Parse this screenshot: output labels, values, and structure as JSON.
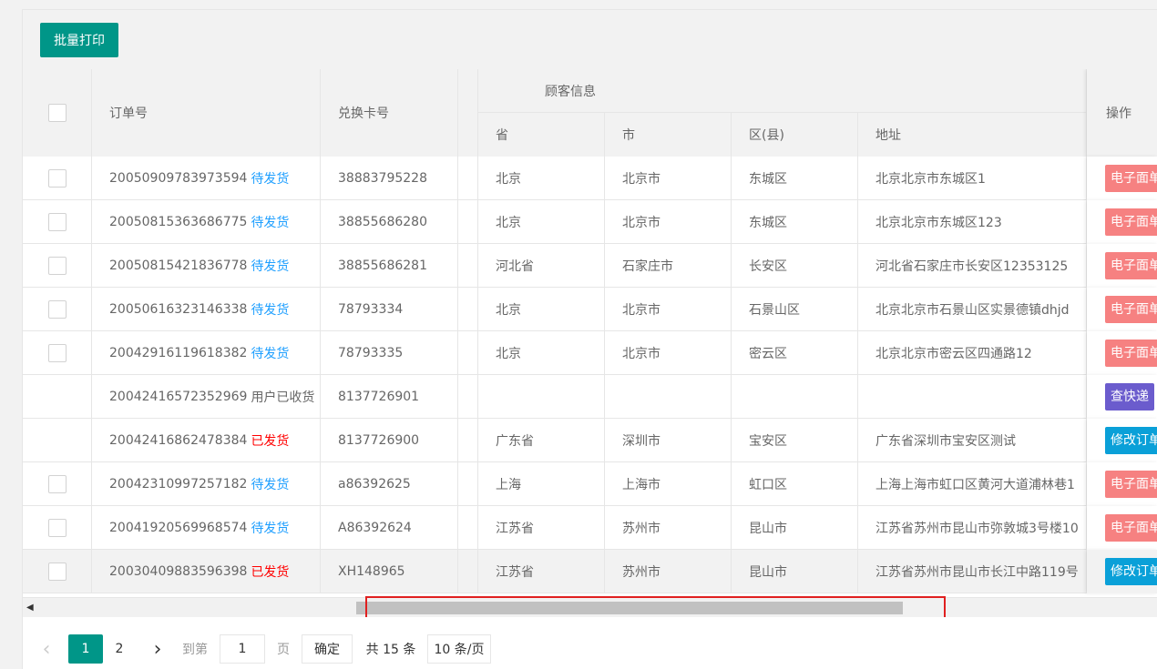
{
  "toolbar": {
    "batch_print_label": "批量打印"
  },
  "header": {
    "order_no": "订单号",
    "card_no": "兑换卡号",
    "customer_info": "顾客信息",
    "province": "省",
    "city": "市",
    "district": "区(县)",
    "address": "地址",
    "operation": "操作"
  },
  "rows": [
    {
      "has_checkbox": true,
      "order": "20050909783973594",
      "status": "待发货",
      "status_type": "pending",
      "card": "38883795228",
      "province": "北京",
      "city": "北京市",
      "district": "东城区",
      "address": "北京北京市东城区1",
      "op": "电子面单",
      "op_type": "red"
    },
    {
      "has_checkbox": true,
      "order": "20050815363686775",
      "status": "待发货",
      "status_type": "pending",
      "card": "38855686280",
      "province": "北京",
      "city": "北京市",
      "district": "东城区",
      "address": "北京北京市东城区123",
      "op": "电子面单",
      "op_type": "red"
    },
    {
      "has_checkbox": true,
      "order": "20050815421836778",
      "status": "待发货",
      "status_type": "pending",
      "card": "38855686281",
      "province": "河北省",
      "city": "石家庄市",
      "district": "长安区",
      "address": "河北省石家庄市长安区12353125",
      "op": "电子面单",
      "op_type": "red"
    },
    {
      "has_checkbox": true,
      "order": "20050616323146338",
      "status": "待发货",
      "status_type": "pending",
      "card": "78793334",
      "province": "北京",
      "city": "北京市",
      "district": "石景山区",
      "address": "北京北京市石景山区实景德镇dhjd",
      "op": "电子面单",
      "op_type": "red"
    },
    {
      "has_checkbox": true,
      "order": "20042916119618382",
      "status": "待发货",
      "status_type": "pending",
      "card": "78793335",
      "province": "北京",
      "city": "北京市",
      "district": "密云区",
      "address": "北京北京市密云区四通路12",
      "op": "电子面单",
      "op_type": "red"
    },
    {
      "has_checkbox": false,
      "order": "20042416572352969",
      "status": "用户已收货",
      "status_type": "received",
      "card": "8137726901",
      "province": "",
      "city": "",
      "district": "",
      "address": "",
      "op": "查快递",
      "op_type": "purple"
    },
    {
      "has_checkbox": false,
      "order": "20042416862478384",
      "status": "已发货",
      "status_type": "shipped",
      "card": "8137726900",
      "province": "广东省",
      "city": "深圳市",
      "district": "宝安区",
      "address": "广东省深圳市宝安区测试",
      "op": "修改订单",
      "op_type": "blue"
    },
    {
      "has_checkbox": true,
      "order": "20042310997257182",
      "status": "待发货",
      "status_type": "pending",
      "card": "a86392625",
      "province": "上海",
      "city": "上海市",
      "district": "虹口区",
      "address": "上海上海市虹口区黄河大道浦林巷1",
      "op": "电子面单",
      "op_type": "red"
    },
    {
      "has_checkbox": true,
      "order": "20041920569968574",
      "status": "待发货",
      "status_type": "pending",
      "card": "A86392624",
      "province": "江苏省",
      "city": "苏州市",
      "district": "昆山市",
      "address": "江苏省苏州市昆山市弥敦城3号楼10",
      "op": "电子面单",
      "op_type": "red"
    },
    {
      "has_checkbox": true,
      "order": "20030409883596398",
      "status": "已发货",
      "status_type": "shipped",
      "card": "XH148965",
      "province": "江苏省",
      "city": "苏州市",
      "district": "昆山市",
      "address": "江苏省苏州市昆山市长江中路119号",
      "op": "修改订单",
      "op_type": "blue"
    }
  ],
  "pager": {
    "prev": "‹",
    "pages": [
      "1",
      "2"
    ],
    "current": "1",
    "next": "›",
    "goto_label": "到第",
    "goto_value": "1",
    "page_unit": "页",
    "ok_label": "确定",
    "total": "共 15 条",
    "page_size": "10 条/页"
  },
  "colors": {
    "accent": "#009688",
    "pending": "#1E9FFF",
    "shipped": "#FF0000"
  }
}
